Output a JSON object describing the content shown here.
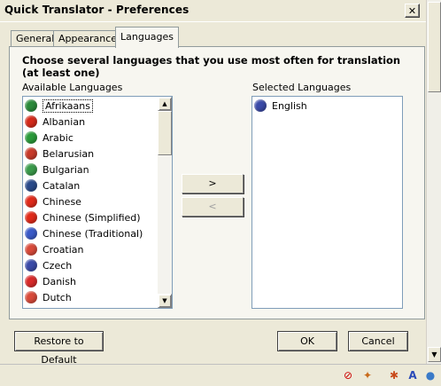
{
  "window": {
    "title": "Quick Translator - Preferences",
    "close_glyph": "✕"
  },
  "tabs": [
    {
      "label": "General",
      "active": false
    },
    {
      "label": "Appearance",
      "active": false
    },
    {
      "label": "Languages",
      "active": true
    }
  ],
  "languages_panel": {
    "instruction": "Choose several languages that you use most often for translation (at least one)",
    "available_label": "Available Languages",
    "selected_label": "Selected Languages",
    "available": [
      {
        "name": "Afrikaans",
        "flag_color": "#2a8a3a"
      },
      {
        "name": "Albanian",
        "flag_color": "#d42a1a"
      },
      {
        "name": "Arabic",
        "flag_color": "#2a9a3a"
      },
      {
        "name": "Belarusian",
        "flag_color": "#c83a2a"
      },
      {
        "name": "Bulgarian",
        "flag_color": "#3a9a4a"
      },
      {
        "name": "Catalan",
        "flag_color": "#2a4a8a"
      },
      {
        "name": "Chinese",
        "flag_color": "#e02a1a"
      },
      {
        "name": "Chinese (Simplified)",
        "flag_color": "#e02a1a"
      },
      {
        "name": "Chinese (Traditional)",
        "flag_color": "#3a5ac8"
      },
      {
        "name": "Croatian",
        "flag_color": "#d84a3a"
      },
      {
        "name": "Czech",
        "flag_color": "#3a4aa8"
      },
      {
        "name": "Danish",
        "flag_color": "#d82a2a"
      },
      {
        "name": "Dutch",
        "flag_color": "#d84a3a"
      }
    ],
    "selected": [
      {
        "name": "English",
        "flag_color": "#3a4aa8"
      }
    ],
    "add_button": ">",
    "remove_button": "<"
  },
  "buttons": {
    "restore": "Restore to Default",
    "ok": "OK",
    "cancel": "Cancel"
  },
  "statusbar_icons": [
    "stop-sign-icon",
    "fox-icon",
    "bug-icon",
    "translate-icon",
    "globe-icon"
  ]
}
